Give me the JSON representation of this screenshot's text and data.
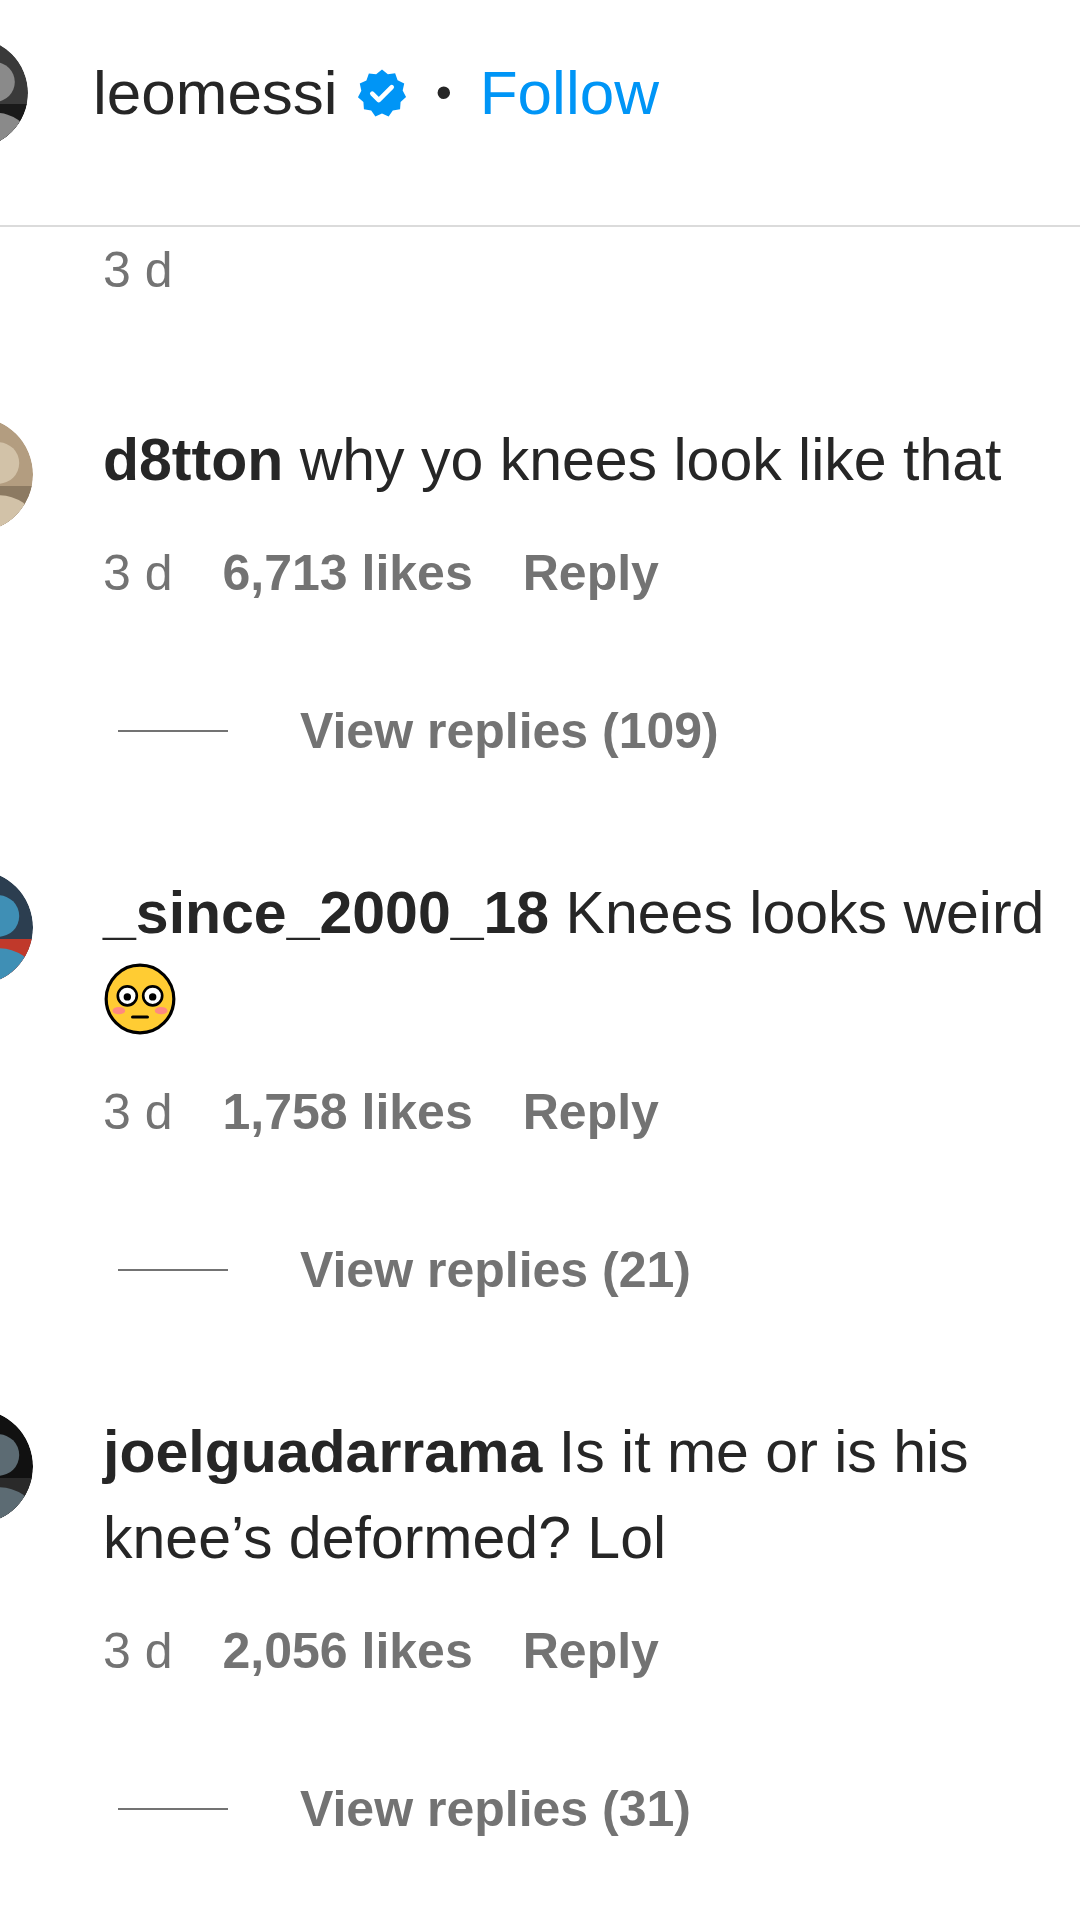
{
  "header": {
    "username": "leomessi",
    "verified": true,
    "separator": "•",
    "follow": "Follow"
  },
  "previous_comment": {
    "time": "3 d"
  },
  "comments": [
    {
      "username": "d8tton",
      "text": "why yo knees look like that",
      "has_emoji": false,
      "time": "3 d",
      "likes": "6,713 likes",
      "reply": "Reply",
      "view_replies": "View replies (109)"
    },
    {
      "username": "_since_2000_18",
      "text": "Knees looks weird",
      "has_emoji": true,
      "time": "3 d",
      "likes": "1,758 likes",
      "reply": "Reply",
      "view_replies": "View replies (21)"
    },
    {
      "username": "joelguadarrama",
      "text": "Is it me or is his knee’s deformed? Lol",
      "has_emoji": false,
      "time": "3 d",
      "likes": "2,056 likes",
      "reply": "Reply",
      "view_replies": "View replies (31)"
    }
  ]
}
